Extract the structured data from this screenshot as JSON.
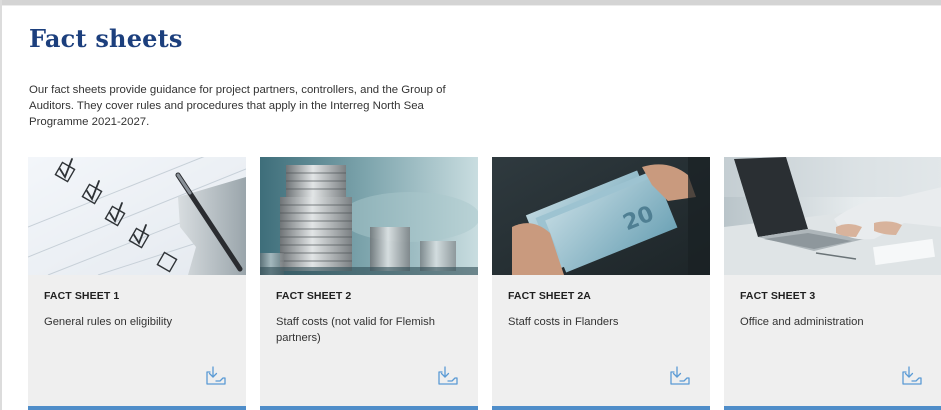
{
  "page": {
    "title": "Fact sheets",
    "intro": "Our fact sheets provide guidance for project partners, controllers, and the Group of Auditors. They cover rules and procedures that apply in the Interreg North Sea Programme 2021-2027."
  },
  "colors": {
    "title": "#1c3f7d",
    "card_background": "#efefef",
    "card_bar": "#4f8dc9",
    "download_icon": "#5b9bd5"
  },
  "cards": [
    {
      "kicker": "FACT SHEET 1",
      "title": "General rules on eligibility",
      "image": "checklist-with-pen-photo",
      "icon": "download-icon"
    },
    {
      "kicker": "FACT SHEET 2",
      "title": "Staff costs (not valid for Flemish partners)",
      "image": "coin-stacks-photo",
      "icon": "download-icon"
    },
    {
      "kicker": "FACT SHEET 2A",
      "title": "Staff costs in Flanders",
      "image": "euro-banknotes-photo",
      "icon": "download-icon"
    },
    {
      "kicker": "FACT SHEET 3",
      "title": "Office and administration",
      "image": "laptop-office-photo",
      "icon": "download-icon"
    }
  ]
}
